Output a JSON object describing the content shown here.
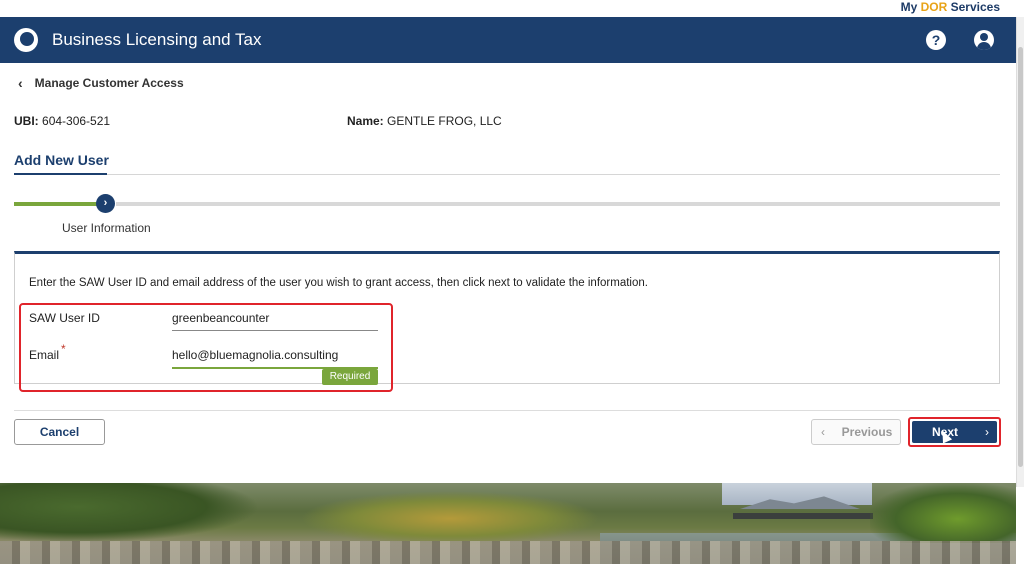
{
  "top_link": {
    "prefix": "My ",
    "highlight": "DOR",
    "suffix": " Services"
  },
  "header": {
    "app_title": "Business Licensing and Tax",
    "help_icon": "help-icon",
    "account_icon": "account-icon"
  },
  "breadcrumb": {
    "back_label": "Manage Customer Access",
    "icon": "chevron-left-icon"
  },
  "account_info": {
    "ubi_label": "UBI:",
    "ubi_value": "604-306-521",
    "name_label": "Name:",
    "name_value": "GENTLE FROG, LLC"
  },
  "section": {
    "title": "Add New User"
  },
  "stepper": {
    "step_label": "User Information",
    "node_symbol": "›",
    "progress": 0.09
  },
  "form": {
    "instructions": "Enter the SAW User ID and email address of the user you wish to grant access, then click next to validate the information.",
    "saw_label": "SAW User ID",
    "saw_value": "greenbeancounter",
    "email_label": "Email",
    "email_required_marker": "*",
    "email_value": "hello@bluemagnolia.consulting",
    "required_badge": "Required"
  },
  "buttons": {
    "cancel": "Cancel",
    "previous": "Previous",
    "next": "Next",
    "prev_chev": "‹",
    "next_chev": "›"
  },
  "colors": {
    "header_bg": "#1c3f6e",
    "accent": "#7aa63c",
    "highlight": "#e0242b",
    "dor": "#e8a317"
  }
}
